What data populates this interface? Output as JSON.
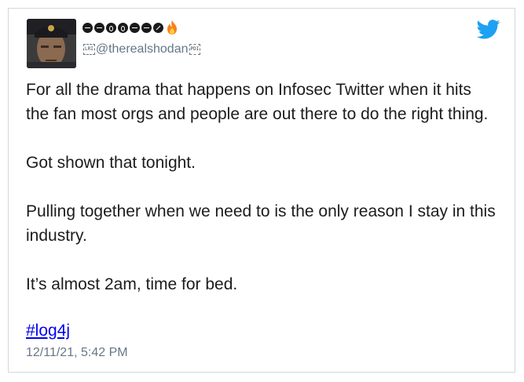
{
  "author": {
    "display_name_icons": [
      "symbol-glyph",
      "symbol-glyph",
      "symbol-glyph",
      "symbol-glyph",
      "symbol-glyph",
      "symbol-glyph",
      "symbol-glyph",
      "fire-emoji"
    ],
    "handle": "@therealshodan",
    "control_left": "LRI",
    "control_right": "PDI"
  },
  "tweet": {
    "paragraphs": [
      "For all the drama that happens on Infosec Twitter when it hits the fan most orgs and people are out there to do the right thing.",
      "Got shown that tonight.",
      "Pulling together when we need to is the only reason I stay in this industry.",
      "It’s almost 2am, time for bed."
    ],
    "hashtag": "#log4j",
    "timestamp": "12/11/21, 5:42 PM"
  },
  "colors": {
    "text": "#1c1c1c",
    "muted": "#657786",
    "link": "#0000ee",
    "twitter_blue": "#1da1f2",
    "border": "#cfd9de"
  },
  "icons": {
    "brand": "twitter-bird-icon"
  }
}
